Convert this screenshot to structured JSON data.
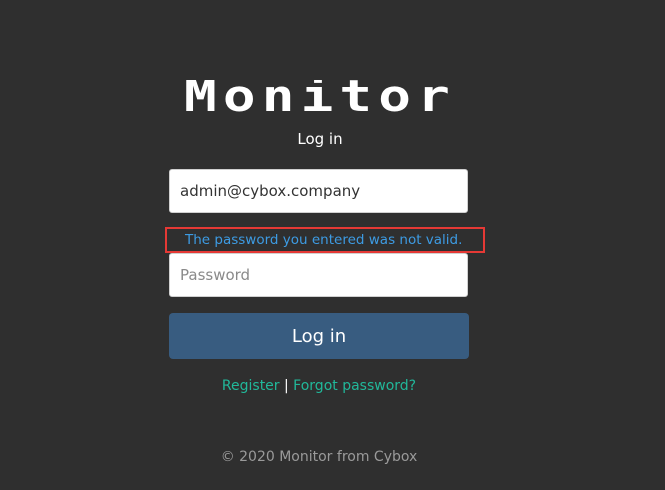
{
  "logo": {
    "text": "Monitor"
  },
  "header": {
    "subtitle": "Log in"
  },
  "form": {
    "email_value": "admin@cybox.company",
    "error_message": "The password you entered was not valid.",
    "password_placeholder": "Password",
    "submit_label": "Log in"
  },
  "links": {
    "register": "Register",
    "separator": "|",
    "forgot_password": "Forgot password?"
  },
  "footer": {
    "text": "© 2020 Monitor from Cybox"
  },
  "colors": {
    "background": "#2f2f2f",
    "button": "#385c80",
    "error_text": "#3d9be3",
    "error_border": "#e53935",
    "link": "#21b89a",
    "footer_text": "#9a9a9a"
  }
}
